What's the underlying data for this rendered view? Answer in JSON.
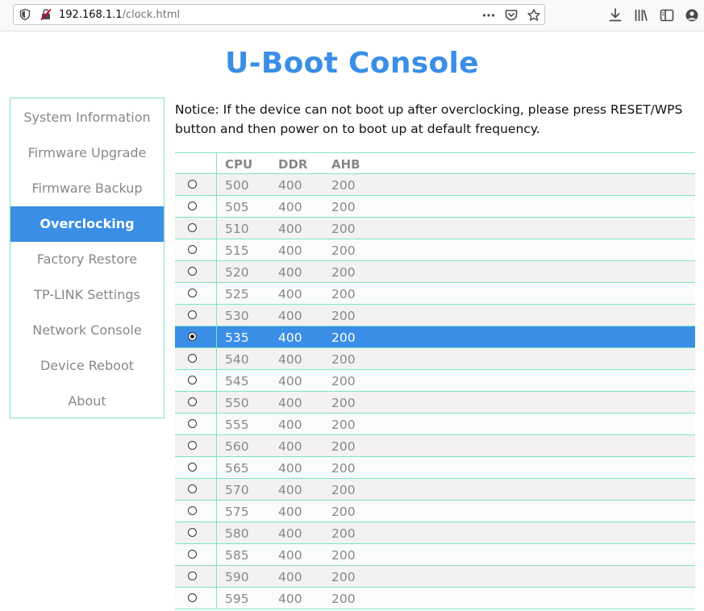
{
  "browser": {
    "url_host": "192.168.1.1",
    "url_path": "/clock.html"
  },
  "page": {
    "title": "U-Boot Console",
    "notice": "Notice: If the device can not boot up after overclocking, please press RESET/WPS button and then power on to boot up at default frequency."
  },
  "sidebar": {
    "items": [
      {
        "label": "System Information"
      },
      {
        "label": "Firmware Upgrade"
      },
      {
        "label": "Firmware Backup"
      },
      {
        "label": "Overclocking",
        "active": true
      },
      {
        "label": "Factory Restore"
      },
      {
        "label": "TP-LINK Settings"
      },
      {
        "label": "Network Console"
      },
      {
        "label": "Device Reboot"
      },
      {
        "label": "About"
      }
    ]
  },
  "table": {
    "headers": [
      "CPU",
      "DDR",
      "AHB"
    ],
    "selected_cpu": "535",
    "rows": [
      [
        "500",
        "400",
        "200"
      ],
      [
        "505",
        "400",
        "200"
      ],
      [
        "510",
        "400",
        "200"
      ],
      [
        "515",
        "400",
        "200"
      ],
      [
        "520",
        "400",
        "200"
      ],
      [
        "525",
        "400",
        "200"
      ],
      [
        "530",
        "400",
        "200"
      ],
      [
        "535",
        "400",
        "200"
      ],
      [
        "540",
        "400",
        "200"
      ],
      [
        "545",
        "400",
        "200"
      ],
      [
        "550",
        "400",
        "200"
      ],
      [
        "555",
        "400",
        "200"
      ],
      [
        "560",
        "400",
        "200"
      ],
      [
        "565",
        "400",
        "200"
      ],
      [
        "570",
        "400",
        "200"
      ],
      [
        "575",
        "400",
        "200"
      ],
      [
        "580",
        "400",
        "200"
      ],
      [
        "585",
        "400",
        "200"
      ],
      [
        "590",
        "400",
        "200"
      ],
      [
        "595",
        "400",
        "200"
      ]
    ]
  },
  "colors": {
    "accent": "#3a8ee6",
    "border": "#7fe3c5"
  }
}
